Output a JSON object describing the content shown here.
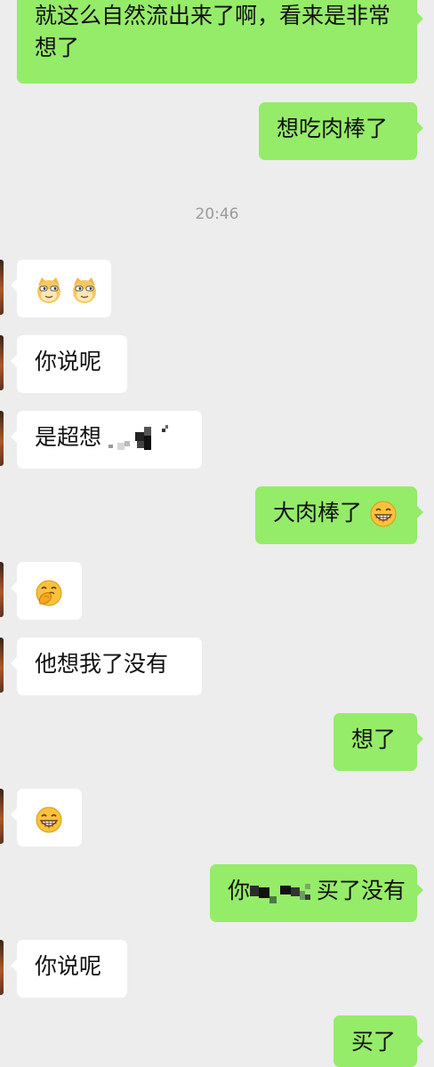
{
  "timestamp": "20:46",
  "messages": [
    {
      "side": "out",
      "text": "就这么自然流出来了啊，看来是非常想了"
    },
    {
      "side": "out",
      "text": "想吃肉棒了"
    },
    {
      "side": "in",
      "emoji": [
        "cat-face-icon",
        "cat-face-icon"
      ]
    },
    {
      "side": "in",
      "text": "你说呢"
    },
    {
      "side": "in",
      "text": "是超想"
    },
    {
      "side": "out",
      "text": "大肉棒了",
      "emoji": "grinning-face-icon"
    },
    {
      "side": "in",
      "emoji": [
        "hand-over-mouth-face-icon"
      ]
    },
    {
      "side": "in",
      "text": "他想我了没有"
    },
    {
      "side": "out",
      "text": "想了"
    },
    {
      "side": "in",
      "emoji": [
        "grinning-face-icon"
      ]
    },
    {
      "side": "out",
      "text_before": "你",
      "text_after": "买了没有"
    },
    {
      "side": "in",
      "text": "你说呢"
    },
    {
      "side": "out",
      "text": "买了"
    }
  ],
  "colors": {
    "background": "#ededed",
    "incoming_bubble": "#ffffff",
    "outgoing_bubble": "#95ec69",
    "timestamp": "#9a9a9a"
  }
}
